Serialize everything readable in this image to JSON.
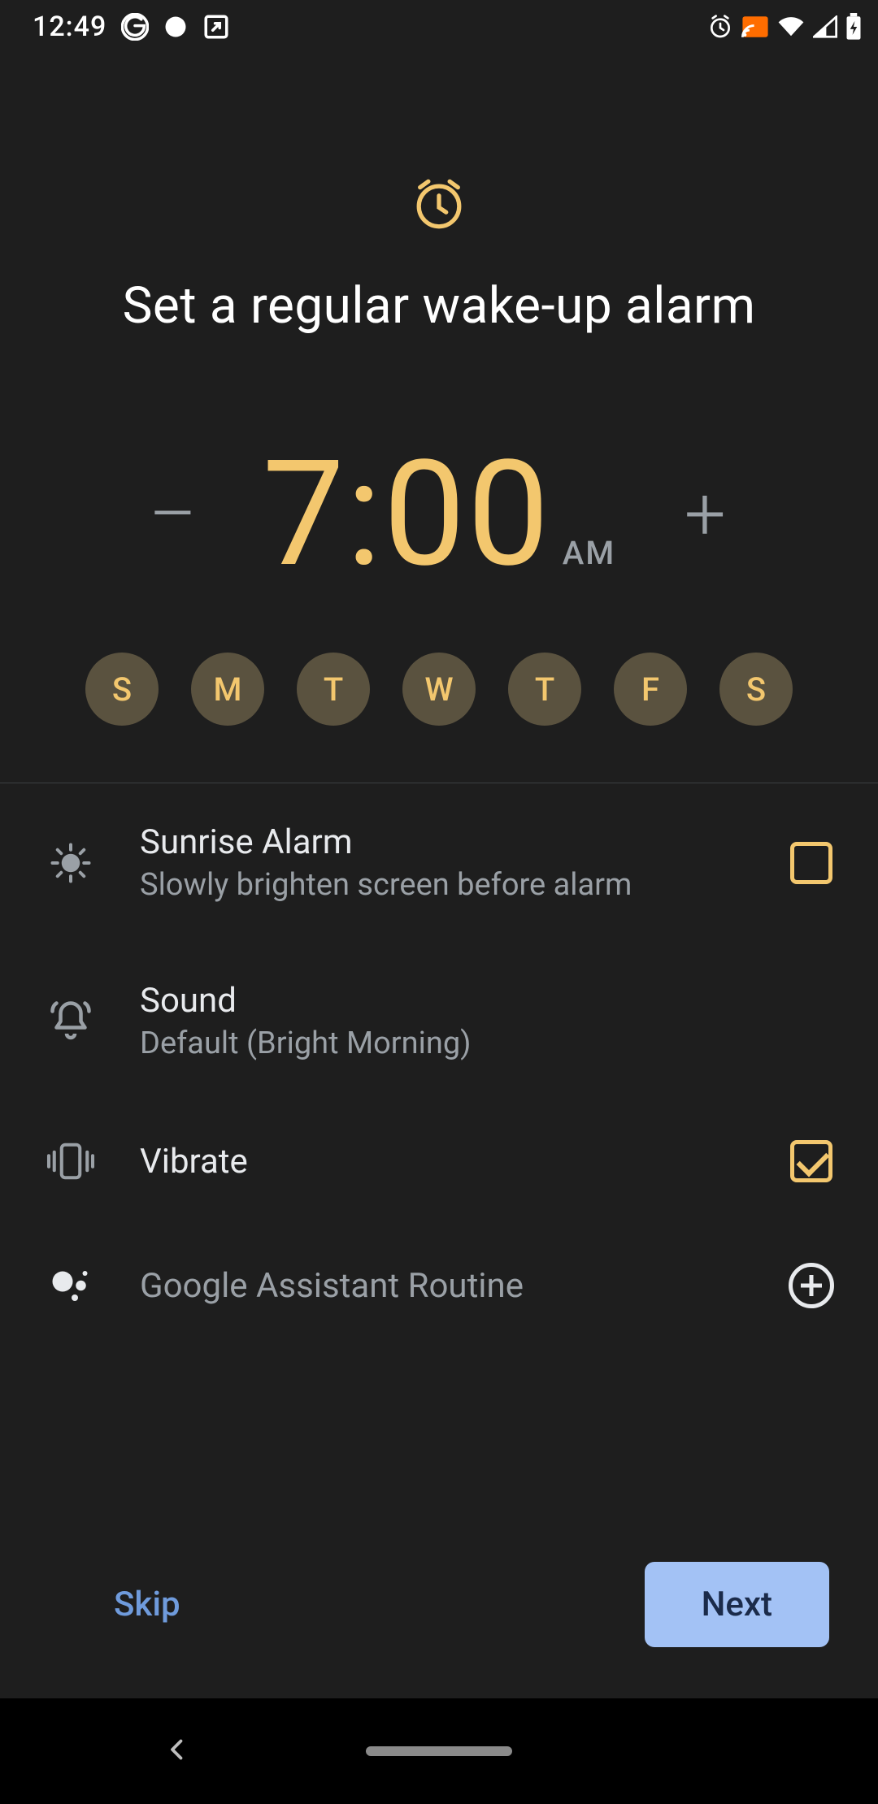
{
  "status": {
    "time": "12:49"
  },
  "header": {
    "title": "Set a regular wake-up alarm"
  },
  "alarm": {
    "time": "7:00",
    "ampm": "AM",
    "minus": "–",
    "plus": "+"
  },
  "days": [
    {
      "letter": "S",
      "selected": true
    },
    {
      "letter": "M",
      "selected": true
    },
    {
      "letter": "T",
      "selected": true
    },
    {
      "letter": "W",
      "selected": true
    },
    {
      "letter": "T",
      "selected": true
    },
    {
      "letter": "F",
      "selected": true
    },
    {
      "letter": "S",
      "selected": true
    }
  ],
  "options": {
    "sunrise": {
      "title": "Sunrise Alarm",
      "subtitle": "Slowly brighten screen before alarm",
      "checked": false
    },
    "sound": {
      "title": "Sound",
      "subtitle": "Default (Bright Morning)"
    },
    "vibrate": {
      "title": "Vibrate",
      "checked": true
    },
    "assistant": {
      "title": "Google Assistant Routine"
    }
  },
  "buttons": {
    "skip": "Skip",
    "next": "Next"
  }
}
